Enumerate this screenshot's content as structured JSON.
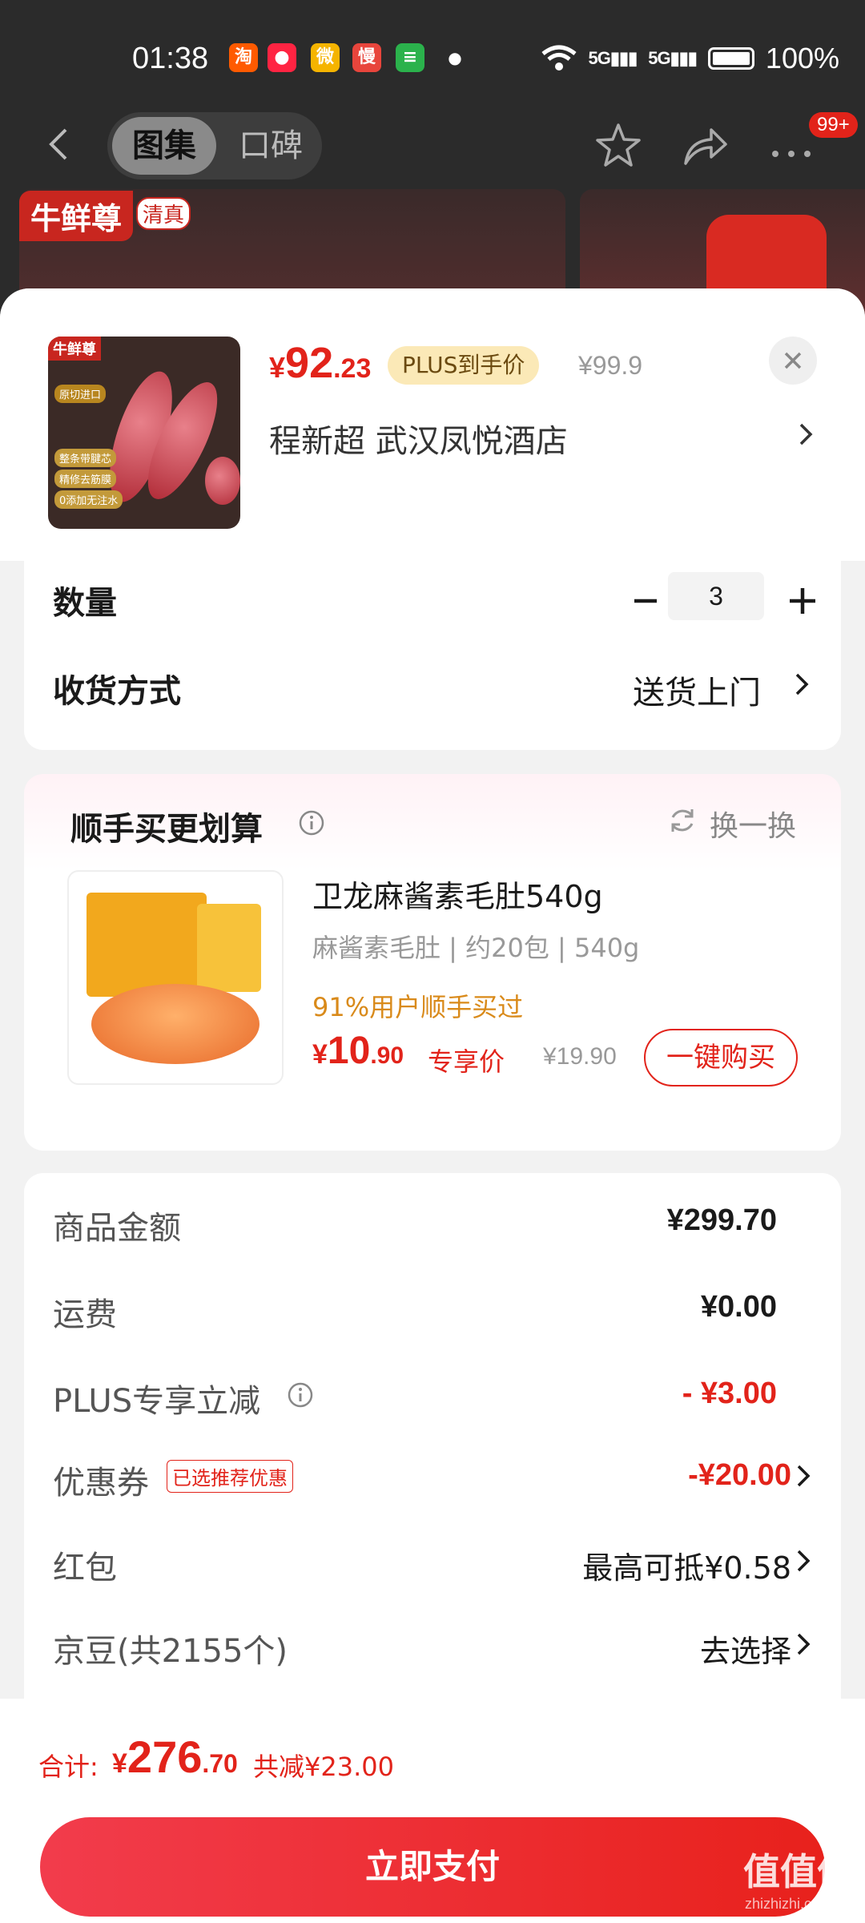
{
  "status_bar": {
    "time": "01:38",
    "apps": [
      {
        "name": "taobao",
        "glyph": "淘",
        "color": "#ff5a00"
      },
      {
        "name": "xiaohongshu",
        "glyph": "●",
        "color": "#ff2442"
      },
      {
        "name": "weibo",
        "glyph": "微",
        "color": "#f5b400"
      },
      {
        "name": "manman",
        "glyph": "慢",
        "color": "#e8453c"
      },
      {
        "name": "wechat",
        "glyph": "≡",
        "color": "#2bb24c"
      }
    ],
    "network1": "5G",
    "network2": "5G",
    "battery": "100%"
  },
  "nav": {
    "tab_gallery": "图集",
    "tab_reviews": "口碑",
    "badge": "99+"
  },
  "background": {
    "brand": "牛鲜尊",
    "halal": "清真"
  },
  "product": {
    "price_yen": "¥",
    "price_int": "92",
    "price_dec": ".23",
    "plus_tag": "PLUS到手价",
    "orig_price": "¥99.9",
    "address": "程新超  武汉凤悦酒店",
    "thumb_brand": "牛鲜尊",
    "thumb_pills": [
      "整条带腱芯",
      "精修去筋膜",
      "0添加无注水"
    ],
    "thumb_origin": "原切进口"
  },
  "quantity": {
    "label": "数量",
    "value": "3"
  },
  "delivery": {
    "label": "收货方式",
    "value": "送货上门"
  },
  "upsell": {
    "title": "顺手买更划算",
    "refresh": "换一换",
    "name": "卫龙麻酱素毛肚540g",
    "spec": "麻酱素毛肚 | 约20包 | 540g",
    "social": "91%用户顺手买过",
    "price_yen": "¥",
    "price_int": "10",
    "price_dec": ".90",
    "exclusive": "专享价",
    "orig_price": "¥19.90",
    "buy_label": "一键购买"
  },
  "summary": {
    "rows": [
      {
        "label": "商品金额",
        "value": "¥299.70"
      },
      {
        "label": "运费",
        "value": "¥0.00"
      },
      {
        "label": "PLUS专享立减",
        "value": "- ¥3.00"
      },
      {
        "label": "优惠券",
        "tag": "已选推荐优惠",
        "value": "-¥20.00"
      },
      {
        "label": "红包",
        "value": "最高可抵¥0.58"
      },
      {
        "label": "京豆(共2155个)",
        "value": "去选择"
      }
    ]
  },
  "checkout": {
    "total_label": "合计:",
    "total_yen": "¥",
    "total_int": "276",
    "total_dec": ".70",
    "saving": "共减¥23.00",
    "pay_label": "立即支付"
  },
  "watermark": {
    "text": "值值值",
    "sub": "zhizhizhi.com"
  },
  "colors": {
    "accent": "#e2231a",
    "plus_bg": "#fbe9b7",
    "social": "#d98a1a"
  }
}
